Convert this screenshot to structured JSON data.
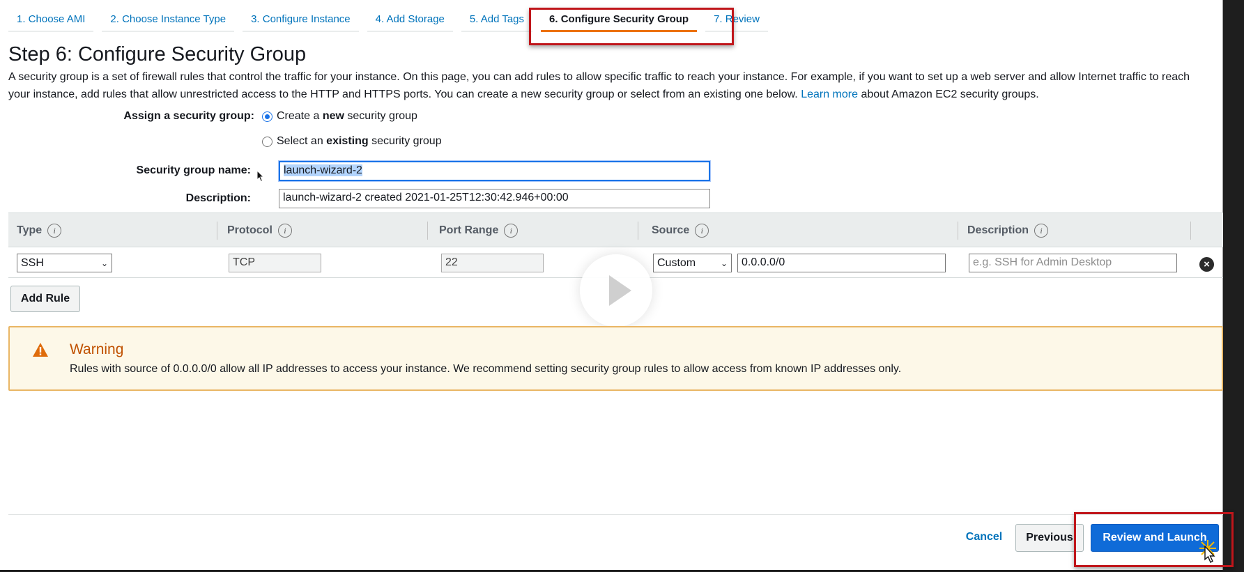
{
  "tabs": [
    {
      "label": "1. Choose AMI"
    },
    {
      "label": "2. Choose Instance Type"
    },
    {
      "label": "3. Configure Instance"
    },
    {
      "label": "4. Add Storage"
    },
    {
      "label": "5. Add Tags"
    },
    {
      "label": "6. Configure Security Group"
    },
    {
      "label": "7. Review"
    }
  ],
  "page": {
    "title": "Step 6: Configure Security Group",
    "intro_text": "A security group is a set of firewall rules that control the traffic for your instance. On this page, you can add rules to allow specific traffic to reach your instance. For example, if you want to set up a web server and allow Internet traffic to reach your instance, add rules that allow unrestricted access to the HTTP and HTTPS ports. You can create a new security group or select from an existing one below.",
    "learn_more": "Learn more",
    "intro_suffix": "about Amazon EC2 security groups."
  },
  "assign": {
    "label": "Assign a security group:",
    "option_new_pre": "Create a",
    "option_new_bold": "new",
    "option_new_post": "security group",
    "option_existing_pre": "Select an",
    "option_existing_bold": "existing",
    "option_existing_post": "security group",
    "selected": "new"
  },
  "group_name": {
    "label": "Security group name:",
    "value": "launch-wizard-2"
  },
  "description": {
    "label": "Description:",
    "value": "launch-wizard-2 created 2021-01-25T12:30:42.946+00:00"
  },
  "table": {
    "headers": [
      "Type",
      "Protocol",
      "Port Range",
      "Source",
      "Description"
    ],
    "rows": [
      {
        "type": "SSH",
        "protocol": "TCP",
        "port_range": "22",
        "source_type": "Custom",
        "source_value": "0.0.0.0/0",
        "description_placeholder": "e.g. SSH for Admin Desktop"
      }
    ],
    "add_rule_label": "Add Rule"
  },
  "warning": {
    "title": "Warning",
    "text": "Rules with source of 0.0.0.0/0 allow all IP addresses to access your instance. We recommend setting security group rules to allow access from known IP addresses only."
  },
  "footer": {
    "cancel_label": "Cancel",
    "previous_label": "Previous",
    "review_label": "Review and Launch"
  },
  "colors": {
    "accent": "#ec7211",
    "link": "#0073bb",
    "primary_button": "#0f6bd8",
    "highlight_box": "#c0161b",
    "warning_title": "#c05100"
  }
}
